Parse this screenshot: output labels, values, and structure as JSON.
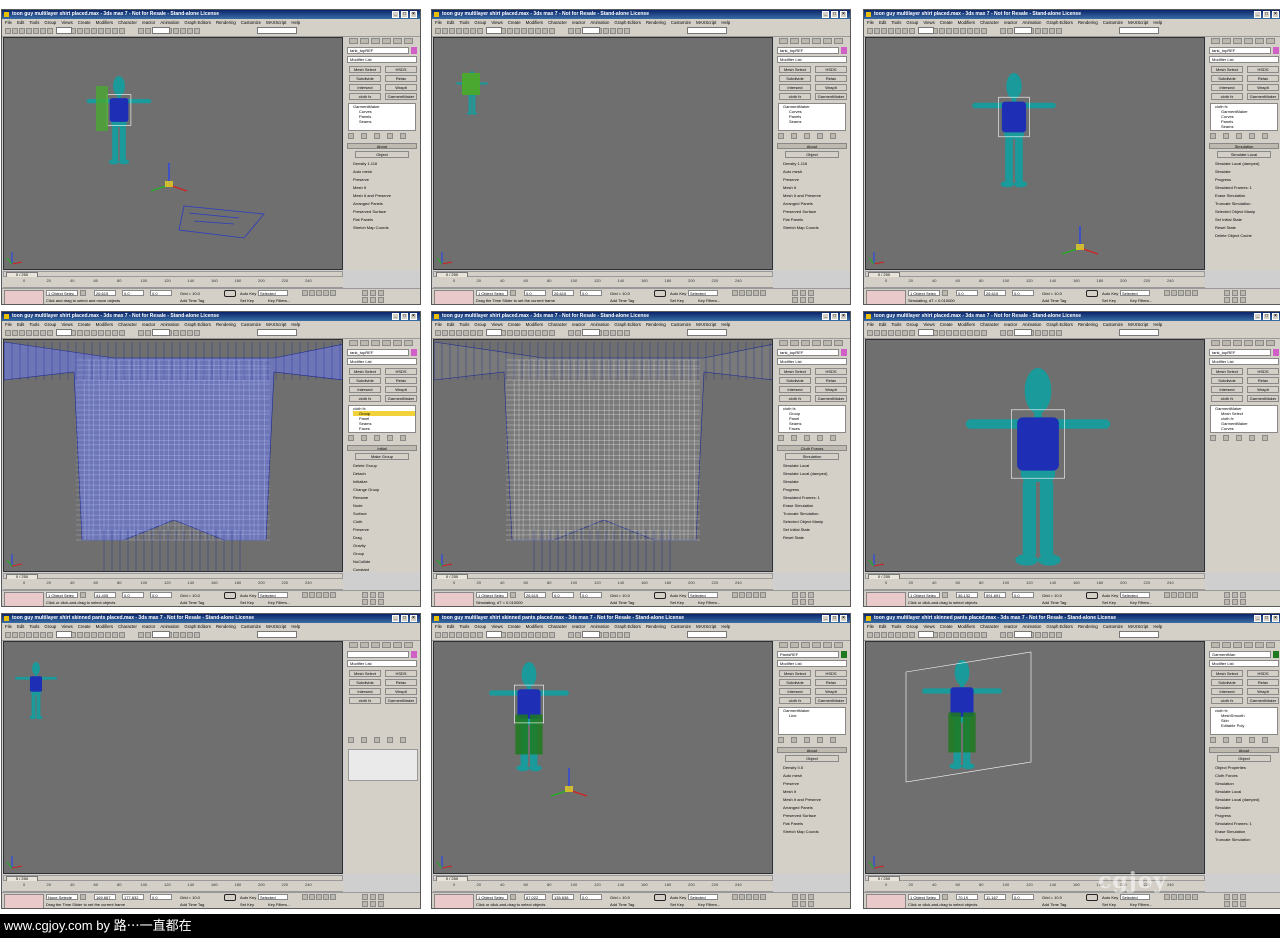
{
  "watermark": "www.cgjoy.com by 路⋯一直都在",
  "corner_logo": "cgjoy",
  "colors": {
    "viewport_bg": "#6f6f6f",
    "body_teal": "#1a9a9a",
    "shirt_blue": "#1f2fb5",
    "pants_green": "#1f7a1f",
    "highlight_yellow": "#f1d23a",
    "title_blue": "#0a246a"
  },
  "menus": [
    "File",
    "Edit",
    "Tools",
    "Group",
    "Views",
    "Create",
    "Modifiers",
    "Character",
    "reactor",
    "Animation",
    "Graph Editors",
    "Rendering",
    "Customize",
    "MAXScript",
    "Help"
  ],
  "panels": [
    {
      "title": "toon guy multilayer shirt placed.max - 3ds max 7 - Not for Resale - Stand-alone License",
      "frame": "0 / 250",
      "object": "tank_topREF",
      "modifier": "Modifier List",
      "buttons": [
        "Mesh Select",
        "HSDS",
        "Subdivide",
        "Relax",
        "Intersect",
        "Wrapit",
        "cloth fx",
        "GarmentMaker"
      ],
      "stack": [
        "GarmentMaker",
        "Curves",
        "Panels",
        "Seams"
      ],
      "section": "About",
      "section2": "Object",
      "options": [
        "Density 1.116",
        "Auto mesh",
        "Preserve",
        "Mesh It",
        "Mesh It and Preserve",
        "Arranged Panels",
        "Preserved Surface",
        "Flat Panels",
        "Stretch Map Coords"
      ],
      "selection": "1 Object Selec",
      "x": "26.615",
      "y": "0.0",
      "z": "0.0",
      "grid": "Grid = 10.0",
      "autokey": "Auto Key",
      "selected": "Selected",
      "prompt": "Click and drag to select and move objects",
      "addtime": "Add Time Tag",
      "setkey": "Set Key",
      "keyfilters": "Key Filters..."
    },
    {
      "title": "toon guy multilayer shirt placed.max - 3ds max 7 - Not for Resale - Stand-alone License",
      "frame": "0 / 250",
      "object": "tank_topREF",
      "modifier": "Modifier List",
      "buttons": [
        "Mesh Select",
        "HSDS",
        "Subdivide",
        "Relax",
        "Intersect",
        "Wrapit",
        "cloth fx",
        "GarmentMaker"
      ],
      "stack": [
        "GarmentMaker",
        "Curves",
        "Panels",
        "Seams"
      ],
      "section": "About",
      "section2": "Object",
      "options": [
        "Density 1.116",
        "Auto mesh",
        "Preserve",
        "Mesh It",
        "Mesh It and Preserve",
        "Arranged Panels",
        "Preserved Surface",
        "Flat Panels",
        "Stretch Map Coords"
      ],
      "selection": "1 Object Selec",
      "x": "0.0",
      "y": "26.615",
      "z": "0.0",
      "grid": "Grid = 10.0",
      "autokey": "Auto Key",
      "selected": "Selected",
      "prompt": "Drag the Time Slider to set the current frame",
      "addtime": "Add Time Tag",
      "setkey": "Set Key",
      "keyfilters": "Key Filters..."
    },
    {
      "title": "toon guy multilayer shirt placed.max - 3ds max 7 - Not for Resale - Stand-alone License",
      "frame": "0 / 250",
      "object": "tank_topREF",
      "modifier": "Modifier List",
      "buttons": [
        "Mesh Select",
        "HSDS",
        "Subdivide",
        "Relax",
        "Intersect",
        "Wrapit",
        "cloth fx",
        "GarmentMaker"
      ],
      "stack": [
        "cloth fx",
        "GarmentMaker",
        "Curves",
        "Panels",
        "Seams"
      ],
      "section": "Simulation",
      "section2": "Simulate Local",
      "options": [
        "Simulate Local (damped)",
        "Simulate",
        "Progress",
        "Simulated Frames: 1",
        "Erase Simulation",
        "Truncate Simulation",
        "Selected Object Manip",
        "Set Initial State",
        "Reset State",
        "Delete Object Cache"
      ],
      "selection": "1 Object Selec",
      "x": "0.0",
      "y": "26.615",
      "z": "0.0",
      "grid": "Grid = 10.0",
      "autokey": "Auto Key",
      "selected": "Selected",
      "prompt": "Simulating, dT = 0.010000",
      "addtime": "Add Time Tag",
      "setkey": "Set Key",
      "keyfilters": "Key Filters..."
    },
    {
      "title": "toon guy multilayer shirt placed.max - 3ds max 7 - Not for Resale - Stand-alone License",
      "frame": "0 / 250",
      "object": "tank_topREF",
      "modifier": "Modifier List",
      "buttons": [
        "Mesh Select",
        "HSDS",
        "Subdivide",
        "Relax",
        "Intersect",
        "Wrapit",
        "cloth fx",
        "GarmentMaker"
      ],
      "stack": [
        "cloth fx",
        "Group",
        "Panel",
        "Seams",
        "Faces"
      ],
      "section": "Initial",
      "section2": "Make Group",
      "options": [
        "Delete Group",
        "Detach",
        "Initialize",
        "Change Group",
        "Rename",
        "Node",
        "Surface",
        "Cloth",
        "Preserve",
        "Drag",
        "Gravity",
        "Group",
        "NoCollide",
        "Constant"
      ],
      "selection": "1 Object Selec",
      "x": "41.405",
      "y": "0.0",
      "z": "0.0",
      "grid": "Grid = 10.0",
      "autokey": "Auto Key",
      "selected": "Selected",
      "prompt": "Click or click-and-drag to select objects",
      "addtime": "Add Time Tag",
      "setkey": "Set Key",
      "keyfilters": "Key Filters..."
    },
    {
      "title": "toon guy multilayer shirt placed.max - 3ds max 7 - Not for Resale - Stand-alone License",
      "frame": "0 / 250",
      "object": "tank_topREF",
      "modifier": "Modifier List",
      "buttons": [
        "Mesh Select",
        "HSDS",
        "Subdivide",
        "Relax",
        "Intersect",
        "Wrapit",
        "cloth fx",
        "GarmentMaker"
      ],
      "stack": [
        "cloth fx",
        "Group",
        "Panel",
        "Seams",
        "Faces"
      ],
      "section": "Cloth Forces",
      "section2": "Simulation",
      "options": [
        "Simulate Local",
        "Simulate Local (damped)",
        "Simulate",
        "Progress",
        "Simulated Frames: 1",
        "Erase Simulation",
        "Truncate Simulation",
        "Selected Object Manip",
        "Set Initial State",
        "Reset State"
      ],
      "selection": "1 Object Selec",
      "x": "26.615",
      "y": "0.0",
      "z": "0.0",
      "grid": "Grid = 10.0",
      "autokey": "Auto Key",
      "selected": "Selected",
      "prompt": "Simulating, dT = 0.010000",
      "addtime": "Add Time Tag",
      "setkey": "Set Key",
      "keyfilters": "Key Filters..."
    },
    {
      "title": "toon guy multilayer shirt placed.max - 3ds max 7 - Not for Resale - Stand-alone License",
      "frame": "0 / 250",
      "object": "tank_topREF",
      "modifier": "Modifier List",
      "buttons": [
        "Mesh Select",
        "HSDS",
        "Subdivide",
        "Relax",
        "Intersect",
        "Wrapit",
        "cloth fx",
        "GarmentMaker"
      ],
      "stack": [
        "GarmentMaker",
        "Mesh Select",
        "cloth fx",
        "GarmentMaker",
        "Curves"
      ],
      "section": "",
      "section2": "",
      "options": [],
      "selection": "1 Object Selec",
      "x": "36.132",
      "y": "591.691",
      "z": "0.0",
      "grid": "Grid = 10.0",
      "autokey": "Auto Key",
      "selected": "Selected",
      "prompt": "Click or click-and-drag to select objects",
      "addtime": "Add Time Tag",
      "setkey": "Set Key",
      "keyfilters": "Key Filters..."
    },
    {
      "title": "toon guy multilayer shirt skinned pants placed.max - 3ds max 7 - Not for Resale - Stand-alone License",
      "frame": "5 / 250",
      "object": "",
      "modifier": "Modifier List",
      "buttons": [
        "Mesh Select",
        "HSDS",
        "Subdivide",
        "Relax",
        "Intersect",
        "Wrapit",
        "cloth fx",
        "GarmentMaker"
      ],
      "stack": [],
      "section": "",
      "section2": "",
      "options": [],
      "selection": "None Selecte",
      "x": "169.667",
      "y": "177.832",
      "z": "0.0",
      "grid": "Grid = 10.0",
      "autokey": "Auto Key",
      "selected": "Selected",
      "prompt": "Drag the Time Slider to set the current frame",
      "addtime": "Add Time Tag",
      "setkey": "Set Key",
      "keyfilters": "Key Filters..."
    },
    {
      "title": "toon guy multilayer shirt skinned pants placed.max - 3ds max 7 - Not for Resale - Stand-alone License",
      "frame": "0 / 250",
      "object": "PantsREF",
      "modifier": "Modifier List",
      "buttons": [
        "Mesh Select",
        "HSDS",
        "Subdivide",
        "Relax",
        "Intersect",
        "Wrapit",
        "cloth fx",
        "GarmentMaker"
      ],
      "stack": [
        "GarmentMaker",
        "Line"
      ],
      "section": "About",
      "section2": "Object",
      "options": [
        "Density 0.5",
        "Auto mesh",
        "Preserve",
        "Mesh It",
        "Mesh It and Preserve",
        "Arranged Panels",
        "Preserved Surface",
        "Flat Panels",
        "Stretch Map Coords"
      ],
      "selection": "1 Object Selec",
      "x": "67.022",
      "y": "135.638",
      "z": "0.0",
      "grid": "Grid = 10.0",
      "autokey": "Auto Key",
      "selected": "Selected",
      "prompt": "Click or click-and-drag to select objects",
      "addtime": "Add Time Tag",
      "setkey": "Set Key",
      "keyfilters": "Key Filters..."
    },
    {
      "title": "toon guy multilayer shirt skinned pants placed.max - 3ds max 7 - Not for Resale - Stand-alone License",
      "frame": "0 / 250",
      "object": "GarmentMan",
      "modifier": "Modifier List",
      "buttons": [
        "Mesh Select",
        "HSDS",
        "Subdivide",
        "Relax",
        "Intersect",
        "Wrapit",
        "cloth fx",
        "GarmentMaker"
      ],
      "stack": [
        "cloth fx",
        "MeshSmooth",
        "Skin",
        "Editable Poly"
      ],
      "section": "About",
      "section2": "Object",
      "options": [
        "Object Properties",
        "Cloth Forces",
        "Simulation",
        "Simulate Local",
        "Simulate Local (damped)",
        "Simulate",
        "Progress",
        "Simulated Frames: 1",
        "Erase Simulation",
        "Truncate Simulation"
      ],
      "selection": "1 Object Selec",
      "x": "70.19",
      "y": "11.167",
      "z": "0.0",
      "grid": "Grid = 10.0",
      "autokey": "Auto Key",
      "selected": "Selected",
      "prompt": "Click or click-and-drag to select objects",
      "addtime": "Add Time Tag",
      "setkey": "Set Key",
      "keyfilters": "Key Filters..."
    }
  ],
  "ticks": [
    "0",
    "20",
    "40",
    "60",
    "80",
    "100",
    "120",
    "140",
    "160",
    "180",
    "200",
    "220",
    "240"
  ]
}
